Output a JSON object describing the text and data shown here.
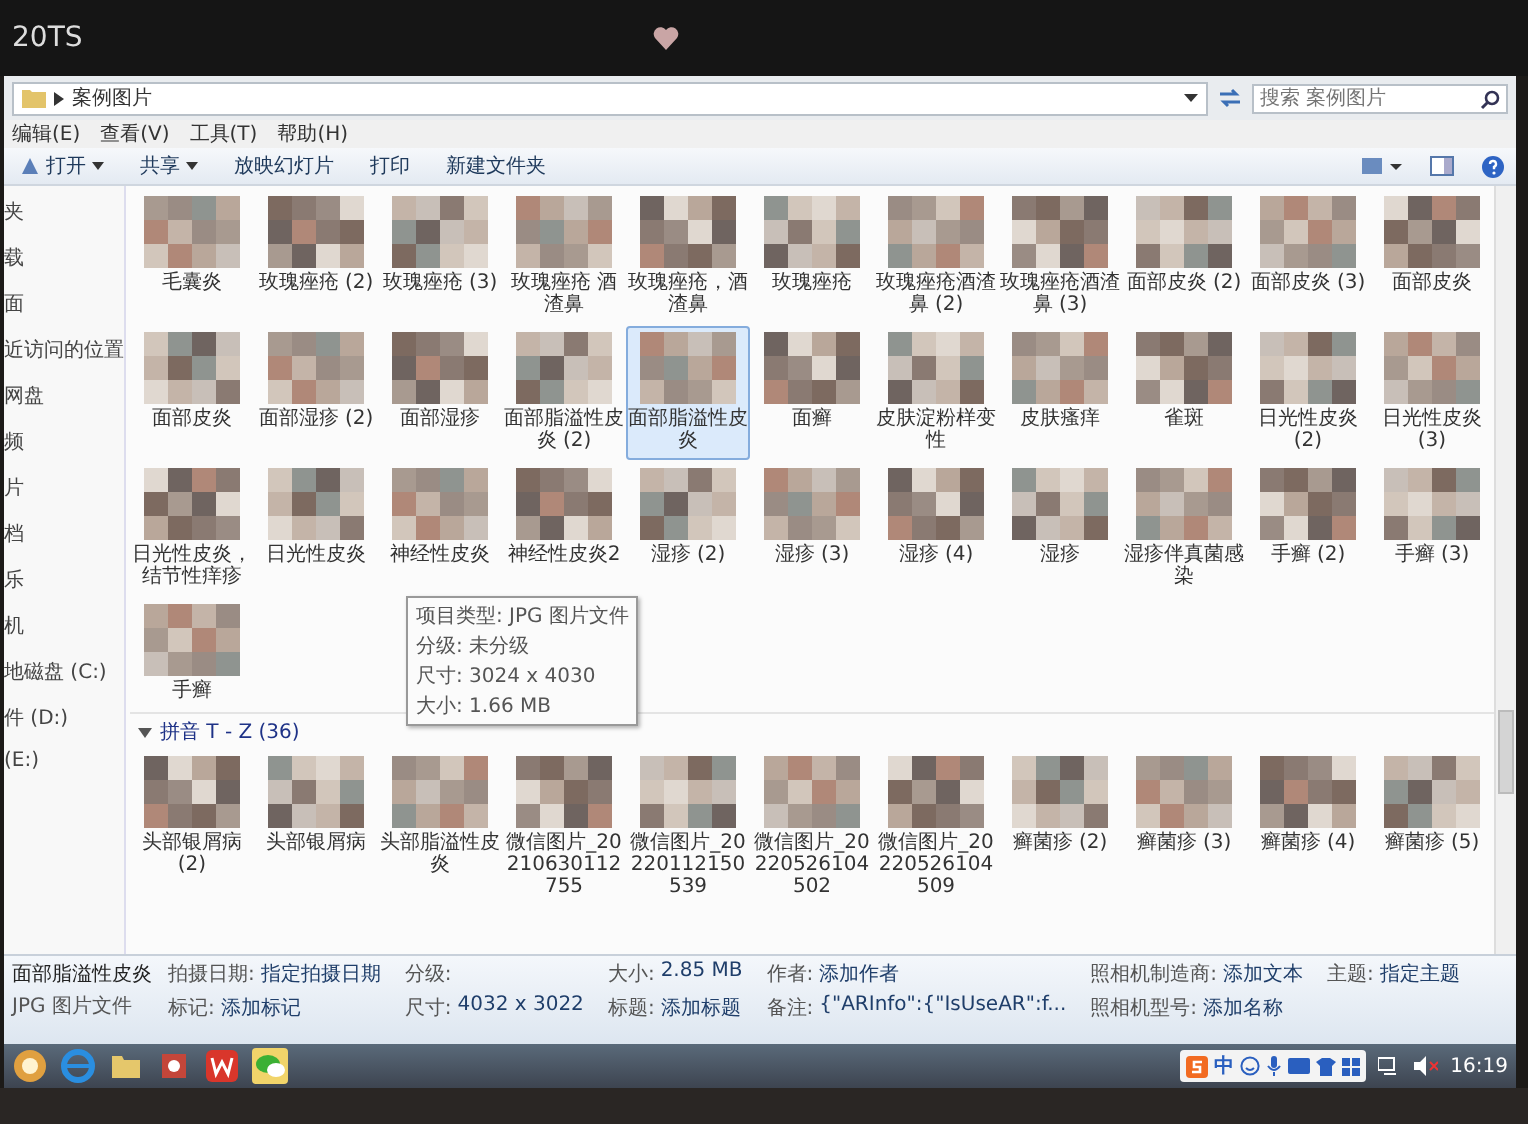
{
  "monitor": {
    "brand": "20TS"
  },
  "address_bar": {
    "path": "案例图片",
    "search_placeholder": "搜索 案例图片"
  },
  "menu": [
    "编辑(E)",
    "查看(V)",
    "工具(T)",
    "帮助(H)"
  ],
  "toolbar": [
    {
      "label": "打开",
      "dropdown": true
    },
    {
      "label": "共享",
      "dropdown": true
    },
    {
      "label": "放映幻灯片",
      "dropdown": false
    },
    {
      "label": "打印",
      "dropdown": false
    },
    {
      "label": "新建文件夹",
      "dropdown": false
    }
  ],
  "nav_pane": [
    "夹",
    "载",
    "面",
    "近访问的位置",
    "网盘",
    "频",
    "片",
    "档",
    "乐",
    "机",
    "地磁盘 (C:)",
    "件 (D:)",
    "(E:)"
  ],
  "file_sections": [
    {
      "files": [
        {
          "name": "毛囊炎",
          "selected": false
        },
        {
          "name": "玫瑰痤疮 (2)",
          "selected": false
        },
        {
          "name": "玫瑰痤疮 (3)",
          "selected": false
        },
        {
          "name": "玫瑰痤疮 酒渣鼻",
          "selected": false
        },
        {
          "name": "玫瑰痤疮，酒渣鼻",
          "selected": false
        },
        {
          "name": "玫瑰痤疮",
          "selected": false
        },
        {
          "name": "玫瑰痤疮酒渣鼻 (2)",
          "selected": false
        },
        {
          "name": "玫瑰痤疮酒渣鼻 (3)",
          "selected": false
        },
        {
          "name": "面部皮炎 (2)",
          "selected": false
        },
        {
          "name": "面部皮炎 (3)",
          "selected": false
        },
        {
          "name": "面部皮炎",
          "selected": false
        },
        {
          "name": "面部皮炎",
          "selected": false
        },
        {
          "name": "面部湿疹 (2)",
          "selected": false
        },
        {
          "name": "面部湿疹",
          "selected": false
        },
        {
          "name": "面部脂溢性皮炎 (2)",
          "selected": false
        },
        {
          "name": "面部脂溢性皮炎",
          "selected": true
        },
        {
          "name": "面癣",
          "selected": false
        },
        {
          "name": "皮肤淀粉样变性",
          "selected": false
        },
        {
          "name": "皮肤瘙痒",
          "selected": false
        },
        {
          "name": "雀斑",
          "selected": false
        },
        {
          "name": "日光性皮炎 (2)",
          "selected": false
        },
        {
          "name": "日光性皮炎 (3)",
          "selected": false
        },
        {
          "name": "日光性皮炎，结节性痒疹",
          "selected": false
        },
        {
          "name": "日光性皮炎",
          "selected": false
        },
        {
          "name": "神经性皮炎",
          "selected": false,
          "tooltip": [
            "项目类型: JPG 图片文件",
            "分级: 未分级",
            "尺寸: 3024 x 4030",
            "大小: 1.66 MB"
          ]
        },
        {
          "name": "神经性皮炎2",
          "selected": false
        },
        {
          "name": "湿疹 (2)",
          "selected": false
        },
        {
          "name": "湿疹 (3)",
          "selected": false
        },
        {
          "name": "湿疹 (4)",
          "selected": false
        },
        {
          "name": "湿疹",
          "selected": false
        },
        {
          "name": "湿疹伴真菌感染",
          "selected": false
        },
        {
          "name": "手癣 (2)",
          "selected": false
        },
        {
          "name": "手癣 (3)",
          "selected": false
        },
        {
          "name": "手癣",
          "selected": false
        }
      ]
    },
    {
      "header": "拼音 T - Z (36)",
      "expanded": true,
      "files": [
        {
          "name": "头部银屑病 (2)",
          "selected": false
        },
        {
          "name": "头部银屑病",
          "selected": false
        },
        {
          "name": "头部脂溢性皮炎",
          "selected": false
        },
        {
          "name": "微信图片_20210630112755",
          "selected": false
        },
        {
          "name": "微信图片_20220112150539",
          "selected": false
        },
        {
          "name": "微信图片_20220526104502",
          "selected": false
        },
        {
          "name": "微信图片_20220526104509",
          "selected": false
        },
        {
          "name": "癣菌疹 (2)",
          "selected": false
        },
        {
          "name": "癣菌疹 (3)",
          "selected": false
        },
        {
          "name": "癣菌疹 (4)",
          "selected": false
        },
        {
          "name": "癣菌疹 (5)",
          "selected": false
        }
      ]
    }
  ],
  "details_pane": {
    "file_name": "面部脂溢性皮炎",
    "file_type": "JPG 图片文件",
    "fields": [
      {
        "label": "拍摄日期:",
        "value": "指定拍摄日期"
      },
      {
        "label": "标记:",
        "value": "添加标记"
      },
      {
        "label": "分级:"
      },
      {
        "label": "尺寸:",
        "value": "4032 x 3022"
      },
      {
        "label": "大小:",
        "value": "2.85 MB"
      },
      {
        "label": "标题:",
        "value": "添加标题"
      },
      {
        "label": "作者:",
        "value": "添加作者"
      },
      {
        "label": "备注:",
        "value": "{\"ARInfo\":{\"IsUseAR\":f..."
      },
      {
        "label": "照相机制造商:",
        "value": "添加文本"
      },
      {
        "label": "照相机型号:",
        "value": "添加名称"
      },
      {
        "label": "主题:",
        "value": "指定主题"
      }
    ]
  },
  "taskbar": {
    "ime": "中",
    "clock": "16:19"
  }
}
